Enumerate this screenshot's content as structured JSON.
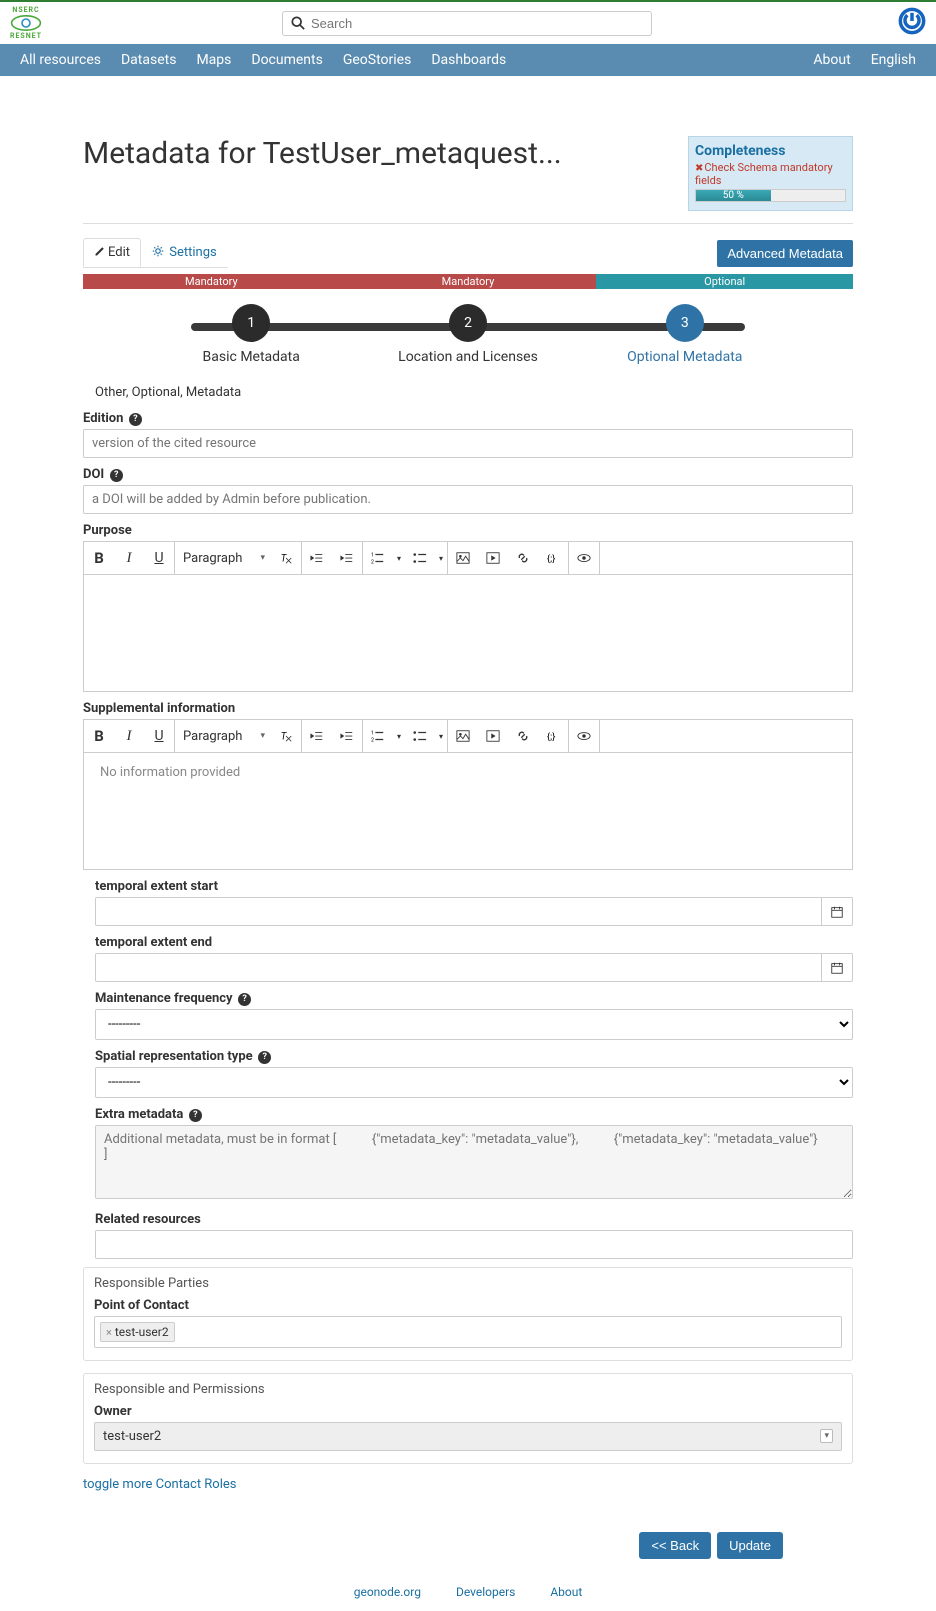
{
  "header": {
    "logo_top": "NSERC",
    "logo_bottom": "RESNET",
    "search_placeholder": "Search"
  },
  "nav": {
    "items": [
      "All resources",
      "Datasets",
      "Maps",
      "Documents",
      "GeoStories",
      "Dashboards"
    ],
    "right": [
      "About",
      "English"
    ]
  },
  "page": {
    "title": "Metadata for TestUser_metaquest...",
    "completeness": {
      "title": "Completeness",
      "error": "Check Schema mandatory fields",
      "percent": "50 %"
    },
    "tabs": {
      "edit": "Edit",
      "settings": "Settings"
    },
    "advanced_btn": "Advanced Metadata",
    "section_labels": {
      "mandatory": "Mandatory",
      "optional": "Optional"
    },
    "wizard": {
      "steps": [
        {
          "num": "1",
          "label": "Basic Metadata"
        },
        {
          "num": "2",
          "label": "Location and Licenses"
        },
        {
          "num": "3",
          "label": "Optional Metadata"
        }
      ]
    },
    "legend": "Other, Optional, Metadata",
    "fields": {
      "edition": {
        "label": "Edition",
        "placeholder": "version of the cited resource"
      },
      "doi": {
        "label": "DOI",
        "placeholder": "a DOI will be added by Admin before publication."
      },
      "purpose": {
        "label": "Purpose",
        "paragraph": "Paragraph"
      },
      "supplemental": {
        "label": "Supplemental information",
        "paragraph": "Paragraph",
        "body": "No information provided"
      },
      "temp_start": {
        "label": "temporal extent start"
      },
      "temp_end": {
        "label": "temporal extent end"
      },
      "maintenance": {
        "label": "Maintenance frequency",
        "value": "---------"
      },
      "spatial": {
        "label": "Spatial representation type",
        "value": "---------"
      },
      "extra": {
        "label": "Extra metadata",
        "placeholder": "Additional metadata, must be in format [           {\"metadata_key\": \"metadata_value\"},           {\"metadata_key\": \"metadata_value\"}           ]"
      },
      "related": {
        "label": "Related resources"
      }
    },
    "responsible": {
      "title": "Responsible Parties",
      "poc_label": "Point of Contact",
      "poc_tag": "test-user2"
    },
    "permissions": {
      "title": "Responsible and Permissions",
      "owner_label": "Owner",
      "owner_value": "test-user2"
    },
    "toggle_roles": "toggle more Contact Roles",
    "buttons": {
      "back": "<< Back",
      "update": "Update"
    }
  },
  "footer": {
    "links": [
      "geonode.org",
      "Developers",
      "About"
    ]
  }
}
